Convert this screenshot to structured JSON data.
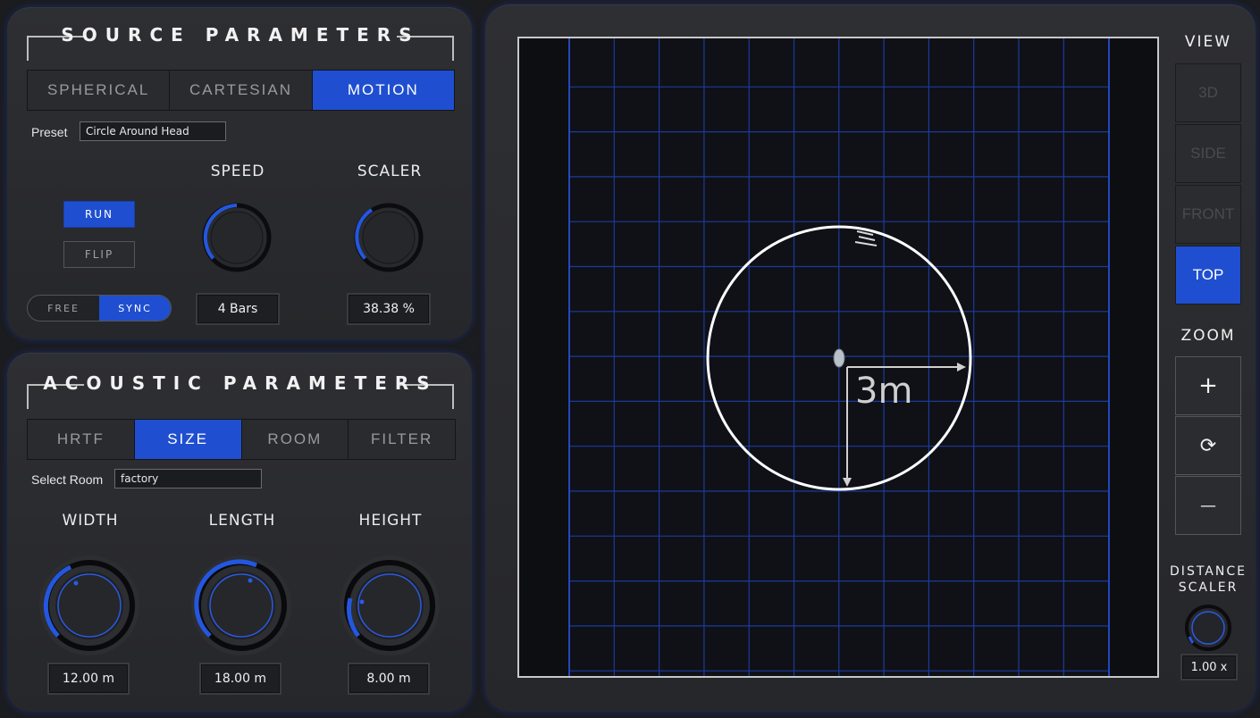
{
  "source": {
    "title": "SOURCE PARAMETERS",
    "tabs": [
      {
        "label": "SPHERICAL",
        "active": false
      },
      {
        "label": "CARTESIAN",
        "active": false
      },
      {
        "label": "MOTION",
        "active": true
      }
    ],
    "preset_label": "Preset",
    "preset_value": "Circle Around Head",
    "run_label": "RUN",
    "flip_label": "FLIP",
    "mode_free": "FREE",
    "mode_sync": "SYNC",
    "speed_label": "SPEED",
    "speed_value": "4 Bars",
    "scaler_label": "SCALER",
    "scaler_value": "38.38 %"
  },
  "acoustic": {
    "title": "ACOUSTIC PARAMETERS",
    "tabs": [
      {
        "label": "HRTF",
        "active": false
      },
      {
        "label": "SIZE",
        "active": true
      },
      {
        "label": "ROOM",
        "active": false
      },
      {
        "label": "FILTER",
        "active": false
      }
    ],
    "room_label": "Select Room",
    "room_value": "factory",
    "width_label": "WIDTH",
    "width_value": "12.00 m",
    "length_label": "LENGTH",
    "length_value": "18.00 m",
    "height_label": "HEIGHT",
    "height_value": "8.00 m"
  },
  "viewer": {
    "radius_label": "3m",
    "view_title": "VIEW",
    "view_buttons": [
      {
        "label": "3D",
        "active": false
      },
      {
        "label": "SIDE",
        "active": false
      },
      {
        "label": "FRONT",
        "active": false
      },
      {
        "label": "TOP",
        "active": true
      }
    ],
    "zoom_title": "ZOOM",
    "zoom_in": "+",
    "zoom_reset": "⟳",
    "zoom_out": "—",
    "distance_title_1": "DISTANCE",
    "distance_title_2": "SCALER",
    "distance_value": "1.00 x"
  },
  "colors": {
    "accent": "#1f4fd0",
    "grid": "#1a3a9a",
    "panel": "#2b2c30"
  }
}
